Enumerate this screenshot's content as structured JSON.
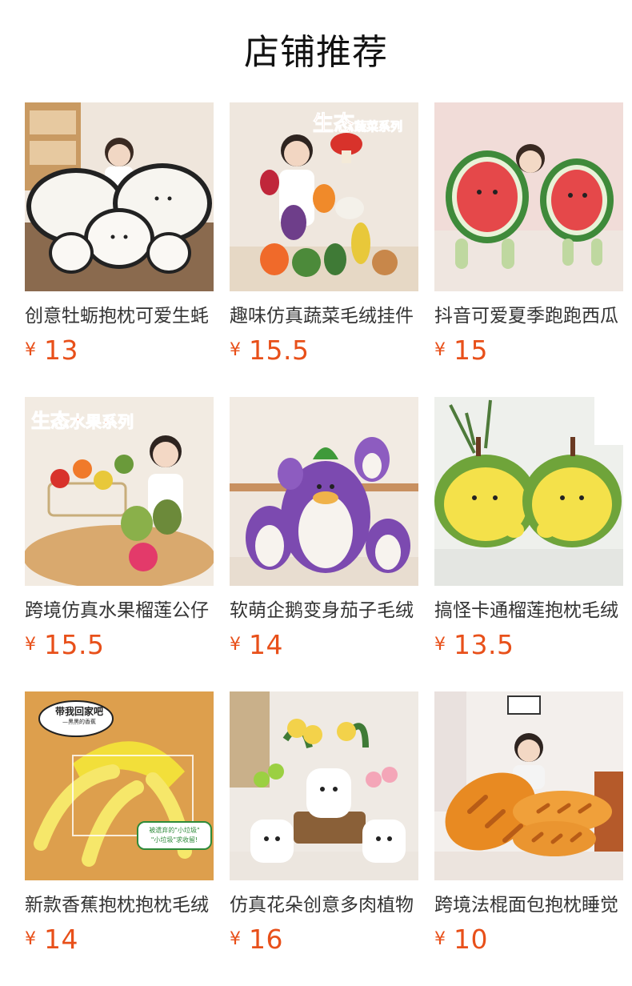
{
  "page": {
    "title": "店铺推荐"
  },
  "products": [
    {
      "name": "创意牡蛎抱枕可爱生蚝",
      "currency": "¥",
      "price": "13",
      "image": "oyster-plush-image"
    },
    {
      "name": "趣味仿真蔬菜毛绒挂件",
      "currency": "¥",
      "price": "15.5",
      "image": "vegetable-plush-image",
      "badge_main": "生态",
      "badge_sub": "蔬菜系列"
    },
    {
      "name": "抖音可爱夏季跑跑西瓜",
      "currency": "¥",
      "price": "15",
      "image": "watermelon-plush-image"
    },
    {
      "name": "跨境仿真水果榴莲公仔",
      "currency": "¥",
      "price": "15.5",
      "image": "fruit-plush-image",
      "badge_main": "生态",
      "badge_sub": "水果系列"
    },
    {
      "name": "软萌企鹅变身茄子毛绒",
      "currency": "¥",
      "price": "14",
      "image": "eggplant-penguin-plush-image"
    },
    {
      "name": "搞怪卡通榴莲抱枕毛绒",
      "currency": "¥",
      "price": "13.5",
      "image": "durian-plush-image"
    },
    {
      "name": "新款香蕉抱枕抱枕毛绒",
      "currency": "¥",
      "price": "14",
      "image": "banana-plush-image",
      "bubble_text": "带我回家吧",
      "bubble_sub": "—黑黑的香蕉",
      "sign_lines": [
        "被遗弃的\"小垃圾\"",
        "\"小垃圾\"求收留!"
      ]
    },
    {
      "name": "仿真花朵创意多肉植物",
      "currency": "¥",
      "price": "16",
      "image": "flower-pot-plush-image"
    },
    {
      "name": "跨境法棍面包抱枕睡觉",
      "currency": "¥",
      "price": "10",
      "image": "baguette-plush-image"
    }
  ],
  "colors": {
    "price": "#e8501a",
    "name": "#333333",
    "title": "#111111"
  }
}
